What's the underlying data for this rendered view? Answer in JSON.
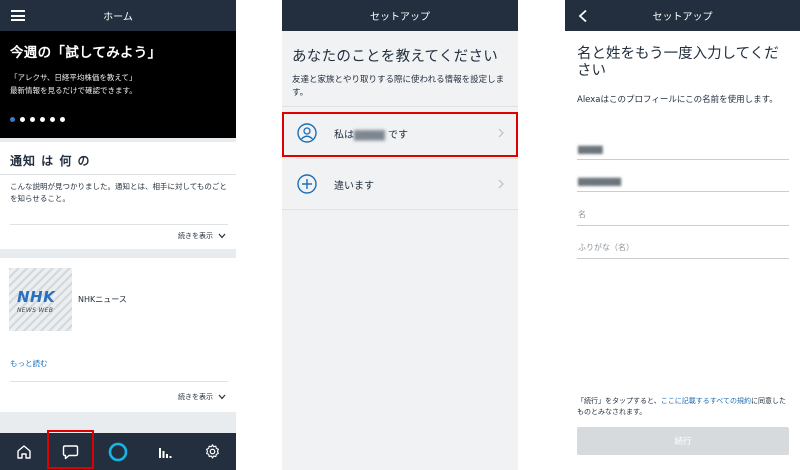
{
  "screen1": {
    "header_title": "ホーム",
    "hero": {
      "title": "今週の「試してみよう」",
      "line1": "「アレクサ、日経平均株価を教えて」",
      "line2": "最新情報を見るだけで確認できます。"
    },
    "notice_card": {
      "title": "通知 は 何 の",
      "text": "こんな説明が見つかりました。通知とは、相手に対してものごとを知らせること。",
      "more": "続きを表示"
    },
    "news_card": {
      "logo_text": "NHK",
      "logo_sub": "NEWS WEB",
      "source": "NHKニュース",
      "read_more": "もっと読む",
      "more": "続きを表示"
    },
    "bottom_nav": [
      "home-icon",
      "chat-icon",
      "alexa-icon",
      "activity-icon",
      "settings-icon"
    ]
  },
  "screen2": {
    "header_title": "セットアップ",
    "heading": "あなたのことを教えてください",
    "subtext": "友達と家族とやり取りする際に使われる情報を設定します。",
    "options": [
      {
        "prefix": "私は",
        "name": "▇▇▇▇",
        "suffix": " です"
      },
      {
        "label": "違います"
      }
    ]
  },
  "screen3": {
    "header_title": "セットアップ",
    "heading": "名と姓をもう一度入力してください",
    "subtext": "Alexaはこのプロフィールにこの名前を使用します。",
    "fields": [
      {
        "value": "▇▇▇▇",
        "placeholder": ""
      },
      {
        "value": "▇▇▇▇▇▇▇",
        "placeholder": ""
      },
      {
        "value": "",
        "placeholder": "名"
      },
      {
        "value": "",
        "placeholder": "ふりがな（名）"
      }
    ],
    "terms_before": "「続行」をタップすると、",
    "terms_link": "ここに記載するすべての規約",
    "terms_after": "に同意したものとみなされます。",
    "continue_label": "続行"
  },
  "colors": {
    "header_bg": "#232f3e",
    "highlight_red": "#e00000",
    "link_blue": "#1f6fb7",
    "alexa_cyan": "#18b4e5"
  }
}
